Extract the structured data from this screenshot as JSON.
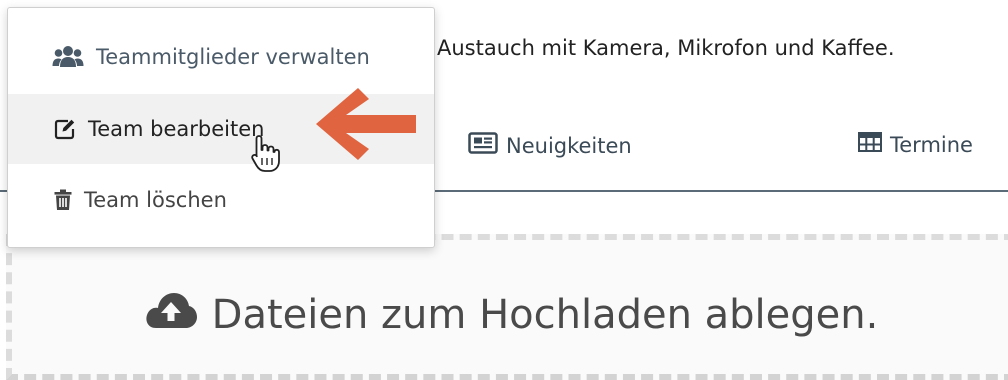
{
  "page": {
    "description": "Austauch mit Kamera, Mikrofon und Kaffee."
  },
  "tabs": [
    {
      "label": "Neuigkeiten",
      "icon": "newspaper-icon"
    },
    {
      "label": "Termine",
      "icon": "table-icon"
    }
  ],
  "menu": {
    "items": [
      {
        "label": "Teammitglieder verwalten",
        "icon": "users-icon"
      },
      {
        "label": "Team bearbeiten",
        "icon": "edit-icon",
        "state": "hovered"
      },
      {
        "label": "Team löschen",
        "icon": "trash-icon"
      }
    ]
  },
  "dropzone": {
    "label": "Dateien zum Hochladen ablegen.",
    "icon": "cloud-upload-icon"
  },
  "colors": {
    "annotation_arrow": "#e0643f",
    "menu_hover": "#f1f1f1",
    "tab_rule": "#5b6b78"
  }
}
